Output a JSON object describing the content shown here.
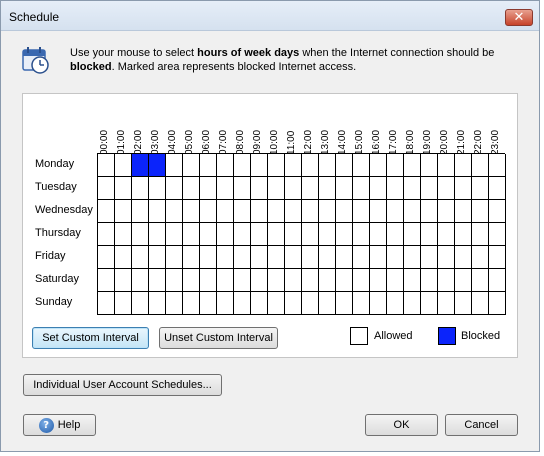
{
  "window": {
    "title": "Schedule",
    "close_glyph": "✕"
  },
  "info": {
    "text_1": "Use your mouse to select ",
    "bold_1": "hours of week days",
    "text_2": " when the Internet connection should be ",
    "bold_2": "blocked",
    "text_3": ". Marked area represents blocked Internet access."
  },
  "hours": [
    "00:00",
    "01:00",
    "02:00",
    "03:00",
    "04:00",
    "05:00",
    "06:00",
    "07:00",
    "08:00",
    "09:00",
    "10:00",
    "11:00",
    "12:00",
    "13:00",
    "14:00",
    "15:00",
    "16:00",
    "17:00",
    "18:00",
    "19:00",
    "20:00",
    "21:00",
    "22:00",
    "23:00"
  ],
  "days": [
    "Monday",
    "Tuesday",
    "Wednesday",
    "Thursday",
    "Friday",
    "Saturday",
    "Sunday"
  ],
  "blocked": {
    "Monday": [
      2,
      3
    ]
  },
  "buttons": {
    "set_custom": "Set Custom Interval",
    "unset_custom": "Unset Custom Interval",
    "individual": "Individual User Account Schedules...",
    "help": "Help",
    "ok": "OK",
    "cancel": "Cancel"
  },
  "legend": {
    "allowed": "Allowed",
    "blocked": "Blocked",
    "allowed_color": "#ffffff",
    "blocked_color": "#0b24fb"
  }
}
